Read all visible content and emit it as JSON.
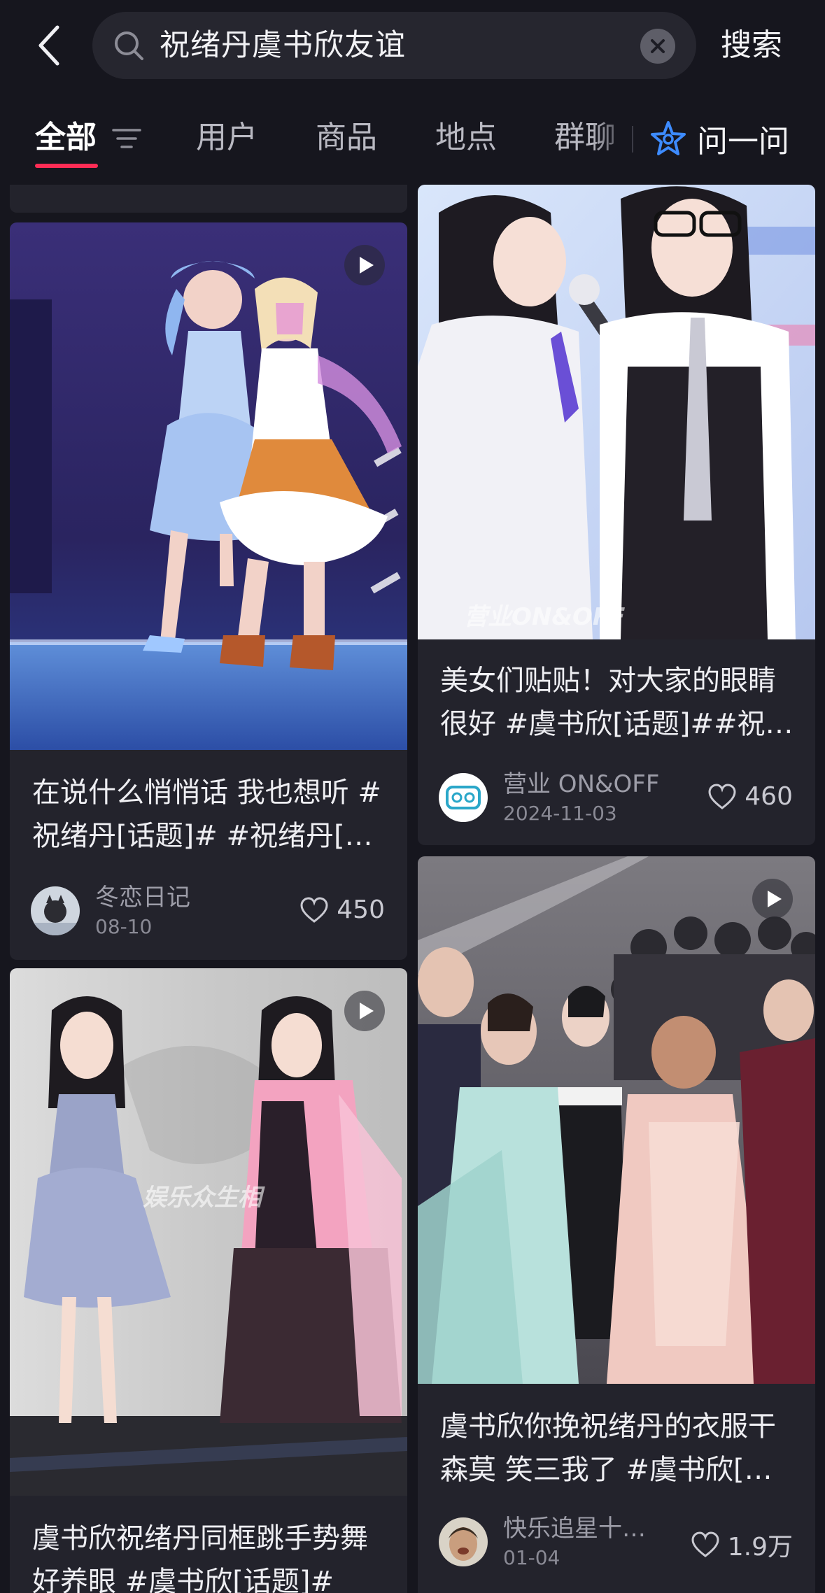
{
  "search": {
    "query": "祝绪丹虞书欣友谊",
    "submit_label": "搜索"
  },
  "tabs": {
    "items": [
      {
        "label": "全部"
      },
      {
        "label": "用户"
      },
      {
        "label": "商品"
      },
      {
        "label": "地点"
      },
      {
        "label": "群聊"
      }
    ],
    "active": "全部",
    "ask_label": "问一问"
  },
  "accent_color": "#fe2c55",
  "feed": {
    "cards": [
      {
        "title": "在说什么悄悄话 我也想听 #祝绪丹[话题]# #祝绪丹[话题]#",
        "author": "冬恋日记",
        "date": "08-10",
        "likes": "450",
        "has_video": true
      },
      {
        "title": "美女们贴贴！对大家的眼睛很好 #虞书欣[话题]##祝绪丹[话题]#",
        "author": "营业 ON&OFF",
        "date": "2024-11-03",
        "likes": "460",
        "has_video": false,
        "watermark": "营业ON&OFF"
      },
      {
        "title": "虞书欣祝绪丹同框跳手势舞好养眼 #虞书欣[话题]#",
        "has_video": true,
        "watermark": "娱乐众生相"
      },
      {
        "title": "虞书欣你挽祝绪丹的衣服干森莫 笑三我了 #虞书欣[话题]#",
        "author": "快乐追星十…",
        "date": "01-04",
        "likes": "1.9万",
        "has_video": true
      }
    ]
  }
}
